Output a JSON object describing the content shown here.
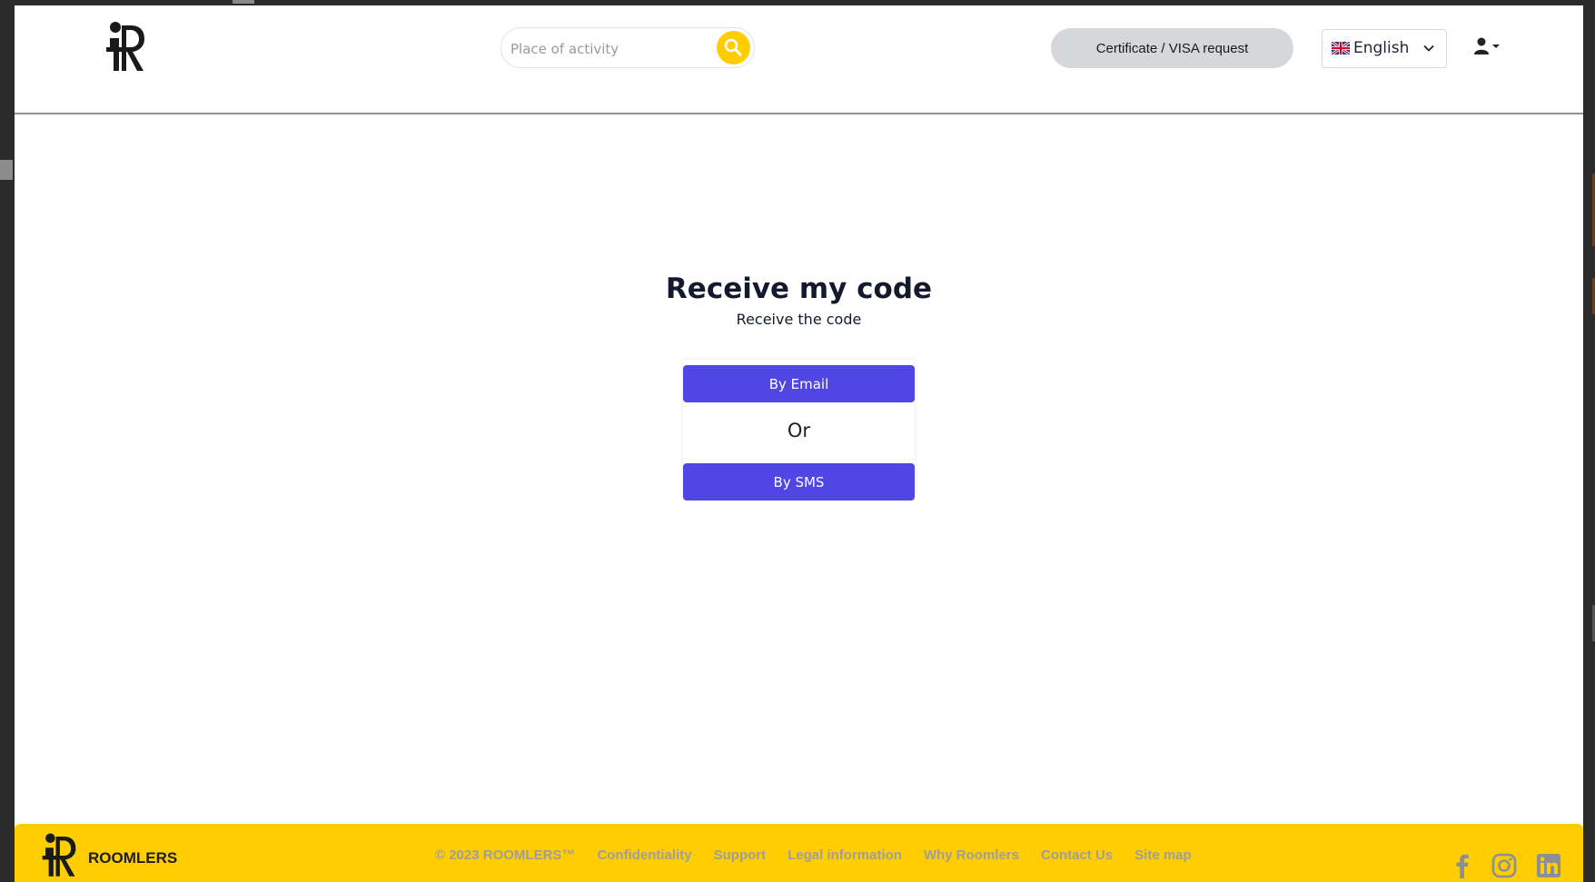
{
  "header": {
    "search": {
      "placeholder": "Place of activity",
      "value": ""
    },
    "cert_button": "Certificate / VISA request",
    "language": {
      "flag": "🇬🇧",
      "label": "English"
    }
  },
  "main": {
    "title": "Receive my code",
    "subtitle": "Receive the code",
    "email_button": "By Email",
    "or_label": "Or",
    "sms_button": "By SMS"
  },
  "footer": {
    "brand": "ROOMLERS",
    "copyright": "© 2023 ROOMLERS™",
    "links": [
      "Confidentiality",
      "Support",
      "Legal information",
      "Why Roomlers",
      "Contact Us",
      "Site map"
    ],
    "social": [
      "facebook-icon",
      "instagram-icon",
      "linkedin-icon"
    ]
  },
  "colors": {
    "accent": "#ffcd00",
    "primary_button": "#4f46e5",
    "cert_button": "#d6d7db",
    "footer_link": "#9e9e9e"
  }
}
